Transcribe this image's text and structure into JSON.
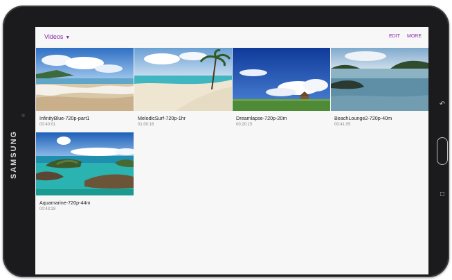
{
  "device": {
    "brand": "SAMSUNG"
  },
  "appbar": {
    "title": "Videos",
    "edit": "EDIT",
    "more": "MORE"
  },
  "videos": [
    {
      "title": "InfinityBlue-720p-part1",
      "duration": "00:40:01",
      "thumb": "beach-waves"
    },
    {
      "title": "MelodicSurf-720p-1hr",
      "duration": "01:00:16",
      "thumb": "palm-beach"
    },
    {
      "title": "Dreamlapse-720p-20m",
      "duration": "00:20:15",
      "thumb": "blue-sky-clouds"
    },
    {
      "title": "BeachLounge2-720p-40m",
      "duration": "00:41:05",
      "thumb": "calm-bay-island"
    },
    {
      "title": "Aquamarine-720p-44m",
      "duration": "00:43:28",
      "thumb": "turquoise-rocks"
    }
  ],
  "colors": {
    "accent": "#8b2aa6",
    "bezel": "#1b1b1d",
    "screen": "#f7f7f8"
  }
}
